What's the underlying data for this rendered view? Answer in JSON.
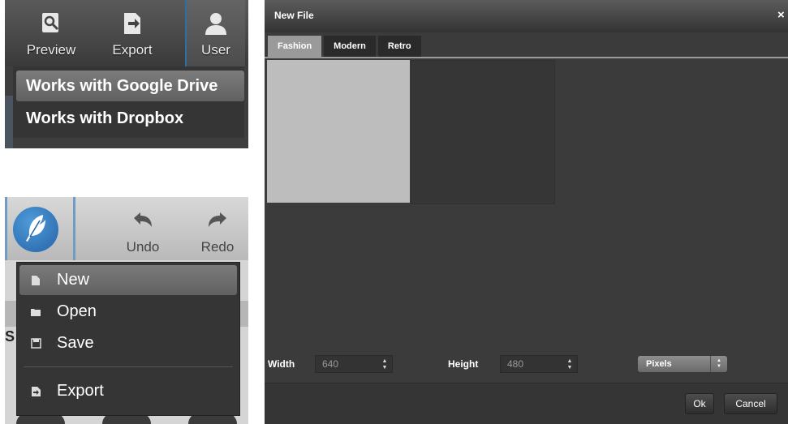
{
  "panel_a": {
    "toolbar": {
      "preview_label": "Preview",
      "export_label": "Export",
      "user_label": "User"
    },
    "menu": {
      "items": [
        {
          "label": "Works with Google Drive",
          "active": true
        },
        {
          "label": "Works with Dropbox",
          "active": false
        }
      ]
    }
  },
  "panel_b": {
    "toolbar": {
      "undo_label": "Undo",
      "redo_label": "Redo"
    },
    "under_letter": "S",
    "menu": {
      "items": [
        {
          "label": "New",
          "icon": "file-icon",
          "active": true
        },
        {
          "label": "Open",
          "icon": "folder-icon",
          "active": false
        },
        {
          "label": "Save",
          "icon": "save-icon",
          "active": false
        },
        {
          "label": "Export",
          "icon": "export-icon",
          "active": false
        }
      ]
    }
  },
  "dialog": {
    "title": "New File",
    "close_glyph": "×",
    "tabs": [
      {
        "label": "Fashion",
        "active": true
      },
      {
        "label": "Modern",
        "active": false
      },
      {
        "label": "Retro",
        "active": false
      }
    ],
    "form": {
      "width_label": "Width",
      "width_value": "640",
      "height_label": "Height",
      "height_value": "480",
      "unit_value": "Pixels"
    },
    "ok_label": "Ok",
    "cancel_label": "Cancel"
  },
  "colors": {
    "accent_blue": "#2f6fa8",
    "dialog_bg": "#3b3b3b",
    "menu_bg": "#353535"
  }
}
